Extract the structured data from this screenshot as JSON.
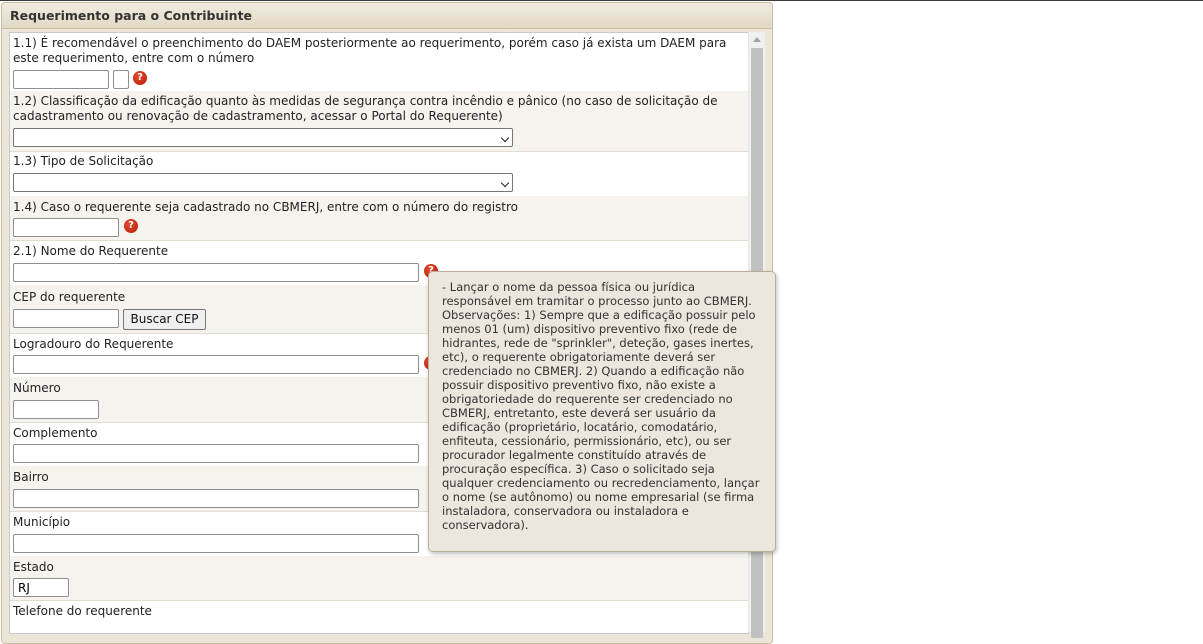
{
  "panel": {
    "title": "Requerimento para o Contribuinte"
  },
  "fields": {
    "daem": {
      "label": "1.1) É recomendável o preenchimento do DAEM posteriormente ao requerimento, porém caso já exista um DAEM para este requerimento, entre com o número",
      "value": "",
      "dv_value": ""
    },
    "classificacao": {
      "label": "1.2) Classificação da edificação quanto às medidas de segurança contra incêndio e pânico (no caso de solicitação de cadastramento ou renovação de cadastramento, acessar o Portal do Requerente)",
      "selected": ""
    },
    "tipo_solicitacao": {
      "label": "1.3) Tipo de Solicitação",
      "selected": ""
    },
    "registro_cbmerj": {
      "label": "1.4) Caso o requerente seja cadastrado no CBMERJ, entre com o número do registro",
      "value": ""
    },
    "nome_requerente": {
      "label": "2.1) Nome do Requerente",
      "value": ""
    },
    "cep": {
      "label": "CEP do requerente",
      "value": "",
      "button": "Buscar CEP"
    },
    "logradouro": {
      "label": "Logradouro do Requerente",
      "value": ""
    },
    "numero": {
      "label": "Número",
      "value": ""
    },
    "complemento": {
      "label": "Complemento",
      "value": ""
    },
    "bairro": {
      "label": "Bairro",
      "value": ""
    },
    "municipio": {
      "label": "Município",
      "value": ""
    },
    "estado": {
      "label": "Estado",
      "value": "RJ"
    },
    "telefone": {
      "label": "Telefone do requerente"
    }
  },
  "help_icon": {
    "icon": "question-icon",
    "glyph": "?",
    "color": "#c0280f"
  },
  "tooltip": {
    "text": "- Lançar o nome da pessoa física ou jurídica responsável em tramitar o processo junto ao CBMERJ. Observações: 1) Sempre que a edificação possuir pelo menos 01 (um) dispositivo preventivo fixo (rede de hidrantes, rede de \"sprinkler\", deteção, gases inertes, etc), o requerente obrigatoriamente deverá ser credenciado no CBMERJ. 2) Quando a edificação não possuir dispositivo preventivo fixo, não existe a obrigatoriedade do requerente ser credenciado no CBMERJ, entretanto, este deverá ser usuário da edificação (proprietário, locatário, comodatário, enfiteuta, cessionário, permissionário, etc), ou ser procurador legalmente constituído através de procuração específica. 3) Caso o solicitado seja qualquer credenciamento ou recredenciamento, lançar o nome (se autônomo) ou nome empresarial (se firma instaladora, conservadora ou instaladora e conservadora)."
  }
}
